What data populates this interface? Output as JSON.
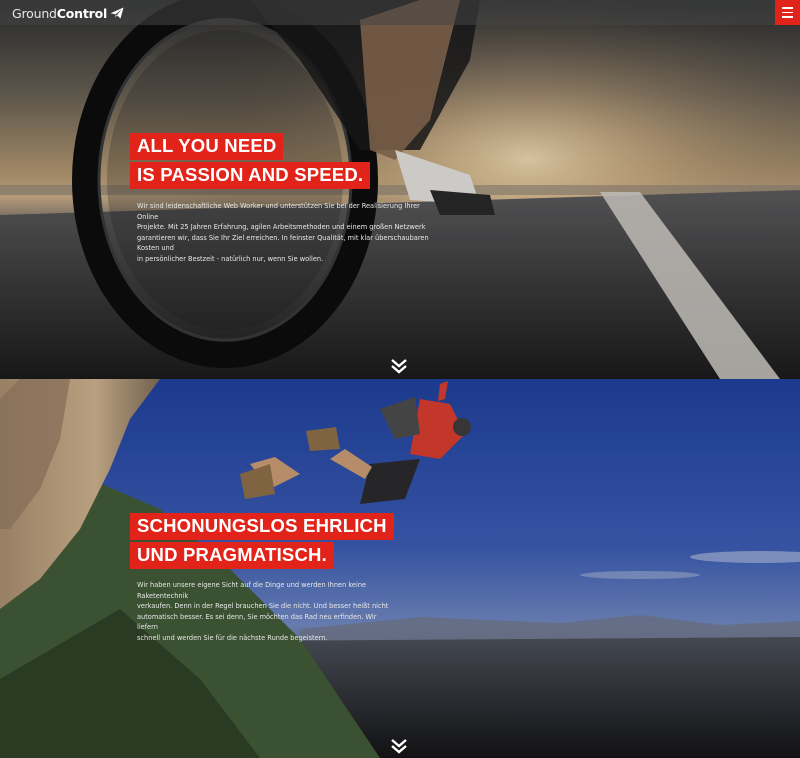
{
  "header": {
    "logo_light": "Ground",
    "logo_bold": "Control",
    "logo_icon": "paper-plane-icon",
    "menu_icon": "hamburger-menu-icon",
    "accent_color": "#e2231a"
  },
  "sections": [
    {
      "headline_line1": "ALL YOU NEED",
      "headline_line2": "IS PASSION AND SPEED.",
      "body_lines": [
        "Wir sind leidenschaftliche Web Worker und unterstützen Sie bei der Realisierung Ihrer Online",
        "Projekte. Mit 25 Jahren Erfahrung, agilen Arbeitsmethoden und einem großen Netzwerk",
        "garantieren wir, dass Sie Ihr Ziel erreichen. In feinster Qualität, mit klar überschaubaren Kosten und",
        "in persönlicher Bestzeit - natürlich nur, wenn Sie wollen."
      ],
      "scroll_icon": "double-chevron-down-icon"
    },
    {
      "headline_line1": "SCHONUNGSLOS EHRLICH",
      "headline_line2": "UND PRAGMATISCH.",
      "body_lines": [
        "Wir haben unsere eigene Sicht auf die Dinge und werden Ihnen keine Raketentechnik",
        "verkaufen. Denn in der Regel brauchen Sie die nicht. Und besser heißt nicht",
        "automatisch besser. Es sei denn, Sie möchten das Rad neu erfinden. Wir liefern",
        "schnell und werden Sie für die nächste Runde begeistern."
      ],
      "scroll_icon": "double-chevron-down-icon"
    }
  ]
}
